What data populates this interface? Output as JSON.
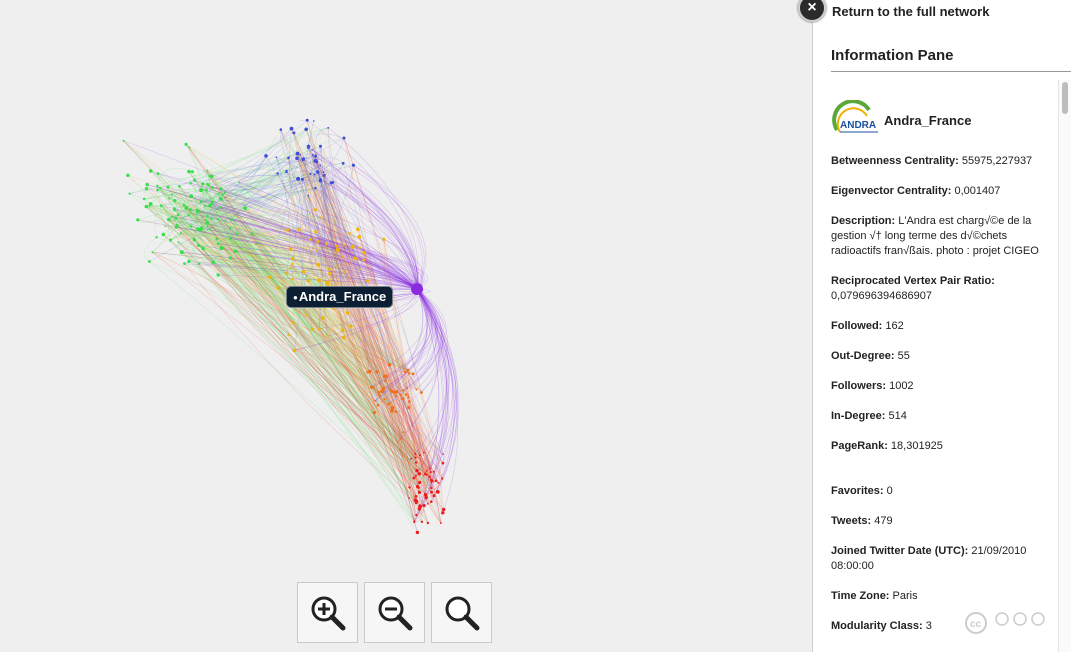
{
  "graph": {
    "selected_label": "Andra_France",
    "zoom_in_icon": "zoom-in-icon",
    "zoom_out_icon": "zoom-out-icon",
    "zoom_reset_icon": "zoom-reset-icon"
  },
  "pane": {
    "return_label": "Return to the full network",
    "title": "Information Pane",
    "profile_name": "Andra_France",
    "logo_text": "ANDRA",
    "fields": [
      {
        "label": "Betweenness Centrality:",
        "value": "55975,227937"
      },
      {
        "label": "Eigenvector Centrality:",
        "value": "0,001407"
      },
      {
        "label": "Description:",
        "value": "L'Andra est charg√©e de la gestion √† long terme des d√©chets radioactifs fran√ßais. photo : projet CIGEO"
      },
      {
        "label": "Reciprocated Vertex Pair Ratio:",
        "value": "0,079696394686907"
      },
      {
        "label": "Followed:",
        "value": "162"
      },
      {
        "label": "Out-Degree:",
        "value": "55"
      },
      {
        "label": "Followers:",
        "value": "1002"
      },
      {
        "label": "In-Degree:",
        "value": "514"
      },
      {
        "label": "PageRank:",
        "value": "18,301925"
      },
      {
        "label": "Favorites:",
        "value": "0"
      },
      {
        "label": "Tweets:",
        "value": "479"
      },
      {
        "label": "Joined Twitter Date (UTC):",
        "value": "21/09/2010 08:00:00"
      },
      {
        "label": "Time Zone:",
        "value": "Paris"
      },
      {
        "label": "Modularity Class:",
        "value": "3"
      }
    ]
  },
  "colors": {
    "selected_node": "#8a2be2",
    "cluster_green": "#33e04a",
    "cluster_yellow": "#f2b400",
    "cluster_blue": "#3c4fd6",
    "cluster_orange": "#f07020",
    "cluster_red": "#ee1c1c"
  }
}
